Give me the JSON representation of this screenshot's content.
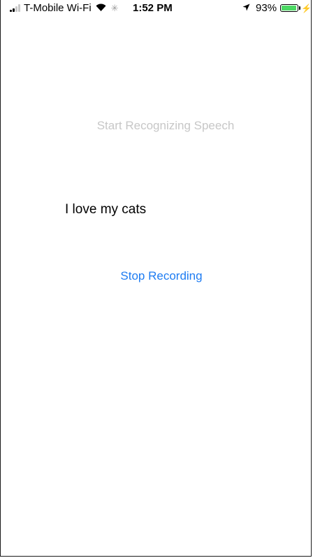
{
  "status_bar": {
    "carrier": "T-Mobile Wi-Fi",
    "time": "1:52 PM",
    "battery_percent": "93%",
    "battery_level": 0.93,
    "signal_icon": "signal-bars-icon",
    "wifi_icon": "wifi-icon",
    "activity_icon": "activity-spinner-icon",
    "location_icon": "location-arrow-icon",
    "charging_icon": "bolt-icon",
    "battery_color": "#4cd964"
  },
  "main": {
    "start_button_label": "Start Recognizing Speech",
    "transcript": "I love my cats",
    "stop_button_label": "Stop Recording",
    "accent_color": "#1e7cf2",
    "disabled_color": "#c7c7c7"
  }
}
